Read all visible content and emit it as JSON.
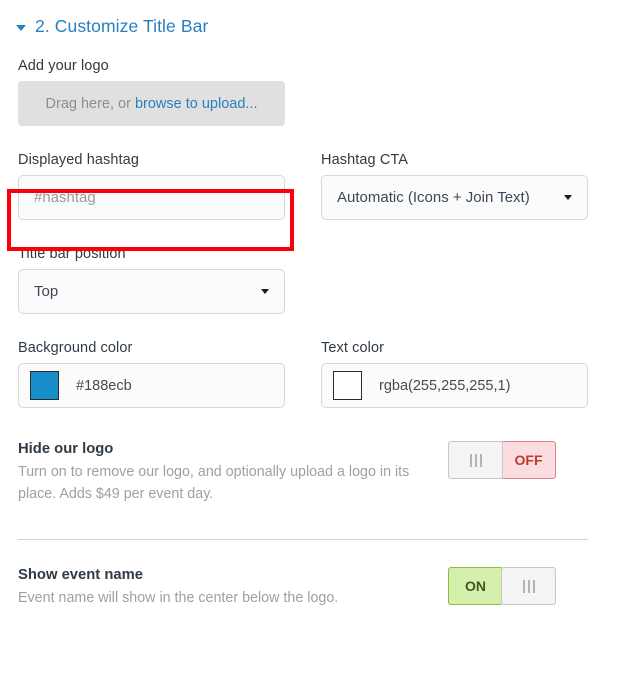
{
  "section": {
    "caret_icon": "caret-down-icon",
    "title": "2. Customize Title Bar"
  },
  "logo_upload": {
    "label": "Add your logo",
    "drop_text": "Drag here, or",
    "link_text": "browse to upload..."
  },
  "hashtag": {
    "label": "Displayed hashtag",
    "placeholder": "#hashtag",
    "value": ""
  },
  "hashtag_cta": {
    "label": "Hashtag CTA",
    "value": "Automatic (Icons + Join Text)",
    "caret_icon": "chevron-down-icon"
  },
  "title_bar_position": {
    "label": "Title bar position",
    "value": "Top",
    "caret_icon": "chevron-down-icon"
  },
  "background_color": {
    "label": "Background color",
    "value": "#188ecb",
    "swatch_color": "#188ecb"
  },
  "text_color": {
    "label": "Text color",
    "value": "rgba(255,255,255,1)",
    "swatch_color": "#ffffff"
  },
  "hide_logo": {
    "title": "Hide our logo",
    "description": "Turn on to remove our logo, and optionally upload a logo in its place. Adds $49 per event day.",
    "state_label": "OFF",
    "state": "off"
  },
  "show_event_name": {
    "title": "Show event name",
    "description": "Event name will show in the center below the logo.",
    "state_label": "ON",
    "state": "on"
  },
  "annotation": {
    "highlight_color": "#fb0007",
    "target": "displayed-hashtag-input"
  }
}
